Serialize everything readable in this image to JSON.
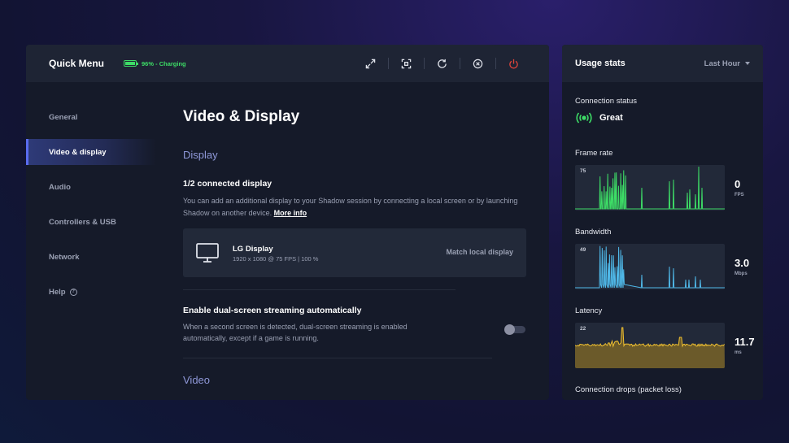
{
  "quick_menu": {
    "title": "Quick Menu",
    "battery": {
      "level": 0.96,
      "text": "96% - Charging",
      "color": "#3ddc66"
    },
    "toolbar": [
      {
        "name": "fullscreen-icon"
      },
      {
        "name": "screenshot-icon"
      },
      {
        "name": "refresh-icon"
      },
      {
        "name": "close-icon"
      },
      {
        "name": "power-icon"
      }
    ]
  },
  "sidebar": {
    "items": [
      {
        "label": "General"
      },
      {
        "label": "Video & display",
        "active": true
      },
      {
        "label": "Audio"
      },
      {
        "label": "Controllers & USB"
      },
      {
        "label": "Network"
      },
      {
        "label": "Help",
        "icon": "help-icon",
        "icon_glyph": "?"
      }
    ]
  },
  "content": {
    "page_title": "Video & Display",
    "display_section": {
      "title": "Display",
      "connected_title": "1/2 connected display",
      "description": "You can add an additional display to your Shadow session by connecting a local screen or by launching Shadow on another device.",
      "more_info": "More info",
      "card": {
        "name": "LG Display",
        "specs": "1920 x 1080 @ 75 FPS  |  100 %",
        "match_label": "Match local display"
      }
    },
    "dual_screen": {
      "title": "Enable dual-screen streaming automatically",
      "description_line1": "When a second screen is detected, dual-screen streaming is enabled",
      "description_line2": "automatically, except if a game is running.",
      "enabled": false
    },
    "video_section": {
      "title": "Video"
    }
  },
  "stats": {
    "title": "Usage stats",
    "range": "Last Hour",
    "connection": {
      "label": "Connection status",
      "value": "Great",
      "color": "#3ddc66"
    },
    "frame_rate": {
      "label": "Frame rate",
      "max": "75",
      "value": "0",
      "unit": "FPS",
      "color": "#3ddc66"
    },
    "bandwidth": {
      "label": "Bandwidth",
      "max": "49",
      "value": "3.0",
      "unit": "Mbps",
      "color": "#4fb8e8"
    },
    "latency": {
      "label": "Latency",
      "max": "22",
      "value": "11.7",
      "unit": "ms",
      "color": "#f0c030"
    },
    "drops": {
      "label": "Connection drops (packet loss)"
    }
  }
}
